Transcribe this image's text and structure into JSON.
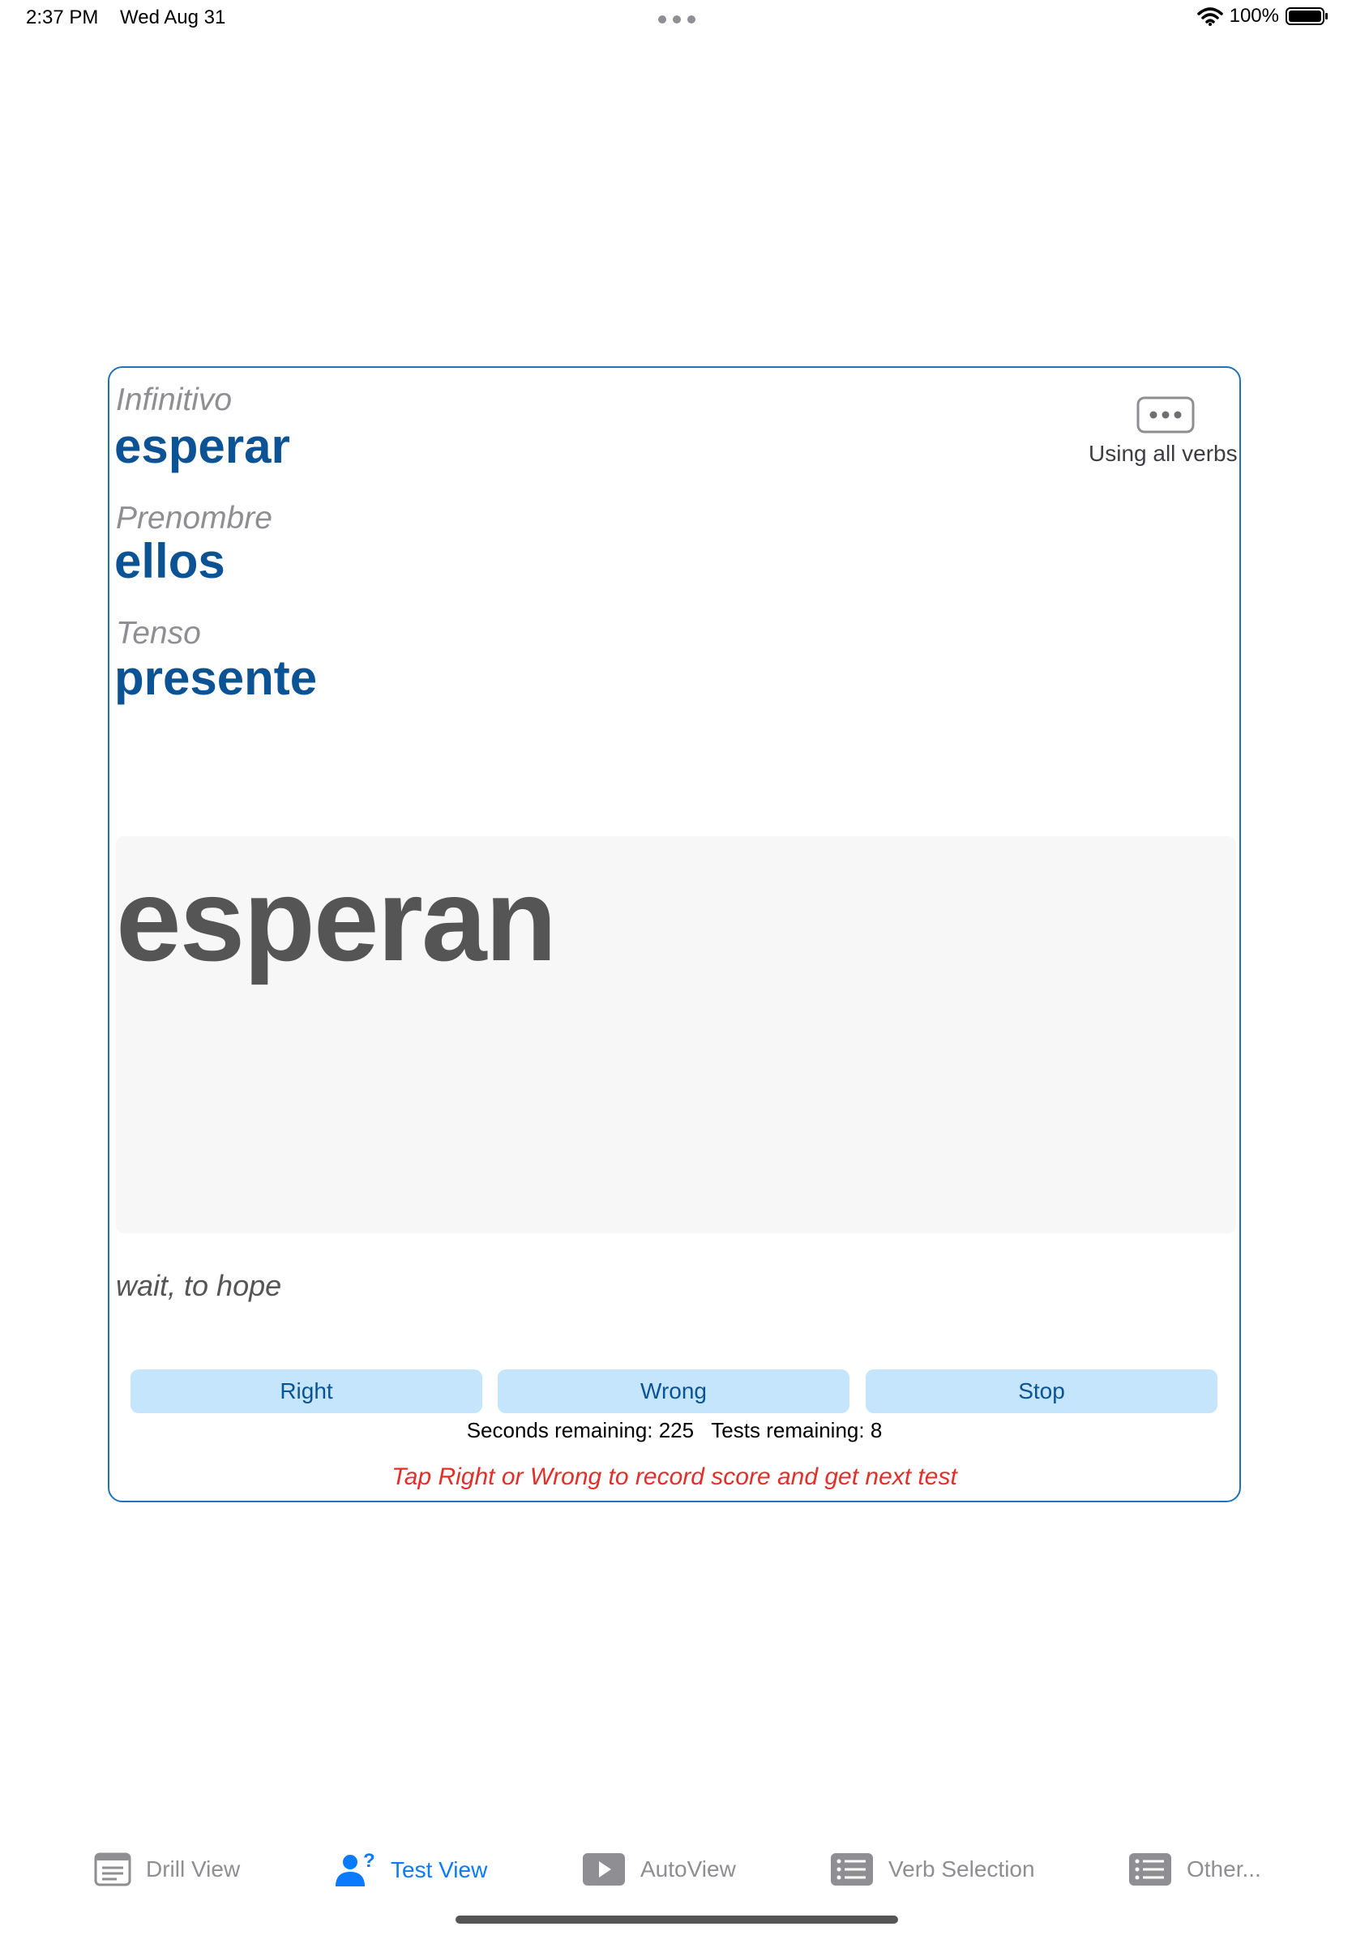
{
  "status_bar": {
    "time": "2:37 PM",
    "date": "Wed Aug 31",
    "battery": "100%",
    "icons": [
      "wifi-icon",
      "battery-icon",
      "multitasking-dots-icon"
    ]
  },
  "card": {
    "infinitive_label": "Infinitivo",
    "infinitive_value": "esperar",
    "pronoun_label": "Prenombre",
    "pronoun_value": "ellos",
    "tense_label": "Tenso",
    "tense_value": "presente",
    "verbs_caption": "Using all verbs",
    "answer": "esperan",
    "meaning": "wait, to hope",
    "buttons": {
      "right": "Right",
      "wrong": "Wrong",
      "stop": "Stop"
    },
    "counts": "Seconds remaining: 225   Tests remaining: 8",
    "hint": "Tap Right or Wrong to record score and get next test"
  },
  "tab_bar": {
    "tabs": [
      {
        "label": "Drill View",
        "icon": "list-doc-icon",
        "active": false
      },
      {
        "label": "Test View",
        "icon": "person-question-icon",
        "active": true
      },
      {
        "label": "AutoView",
        "icon": "play-icon",
        "active": false
      },
      {
        "label": "Verb Selection",
        "icon": "list-icon",
        "active": false
      },
      {
        "label": "Other...",
        "icon": "list-icon",
        "active": false
      }
    ]
  },
  "colors": {
    "accent_blue": "#0a7aff",
    "value_blue": "#0b5394",
    "card_border": "#1e73b8",
    "button_bg": "#c4e5fb",
    "hint_red": "#e0302a"
  }
}
